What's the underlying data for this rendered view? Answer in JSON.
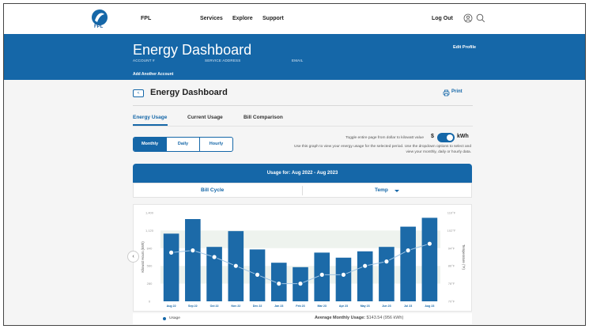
{
  "nav": {
    "logo_text": "FPL",
    "brand": "FPL",
    "links": [
      "Services",
      "Explore",
      "Support"
    ],
    "logout": "Log Out"
  },
  "hero": {
    "title": "Energy Dashboard",
    "account_label": "ACCOUNT #",
    "service_address_label": "SERVICE ADDRESS",
    "email_label": "EMAIL",
    "add_account": "Add Another Account",
    "edit_profile": "Edit Profile"
  },
  "section": {
    "back": "<",
    "title": "Energy Dashboard",
    "print": "Print"
  },
  "tabs": [
    "Energy Usage",
    "Current Usage",
    "Bill Comparison"
  ],
  "periods": [
    "Monthly",
    "Daily",
    "Hourly"
  ],
  "toggle": {
    "note": "Toggle entire page from dollar to kilowatt value",
    "dollar": "$",
    "kwh": "kWh",
    "graph_note": "Use this graph to view your energy usage for the selected period. Use the dropdown options to select and view your monthly, daily or hourly data."
  },
  "usage_banner": {
    "title": "Usage for: Aug 2022 - Aug 2023",
    "bill_cycle": "Bill Cycle",
    "temp": "Temp"
  },
  "colors": {
    "primary": "#1567a8",
    "bar": "#1c6aa8",
    "temp_line": "#9fc4e4"
  },
  "chart_data": {
    "type": "bar",
    "categories": [
      "Aug 22",
      "Sep 22",
      "Oct 22",
      "Nov 22",
      "Dec 22",
      "Jan 23",
      "Feb 23",
      "Mar 23",
      "Apr 23",
      "May 23",
      "Jun 23",
      "Jul 23",
      "Aug 23"
    ],
    "series": [
      {
        "name": "Usage",
        "values": [
          1070,
          1300,
          860,
          1110,
          820,
          610,
          540,
          770,
          690,
          790,
          860,
          1180,
          1320
        ]
      },
      {
        "name": "Temp",
        "axis": "right",
        "values": [
          92,
          93,
          90,
          86,
          82,
          78,
          78,
          82,
          82,
          86,
          88,
          93,
          96
        ]
      }
    ],
    "ylabel": "Kilowatt Hours (kWh)",
    "y2label": "Temperature (°F)",
    "yticks": [
      "0",
      "280",
      "560",
      "840",
      "1,120",
      "1,400"
    ],
    "ylim": [
      0,
      1400
    ],
    "y2ticks": [
      "70°F",
      "78°F",
      "86°F",
      "94°F",
      "102°F",
      "110°F"
    ],
    "y2lim": [
      70,
      110
    ],
    "legend": "Usage",
    "average": {
      "label": "Average Monthly Usage:",
      "value": "$143.54 (956 kWh)"
    }
  },
  "carousel_prev": "‹"
}
